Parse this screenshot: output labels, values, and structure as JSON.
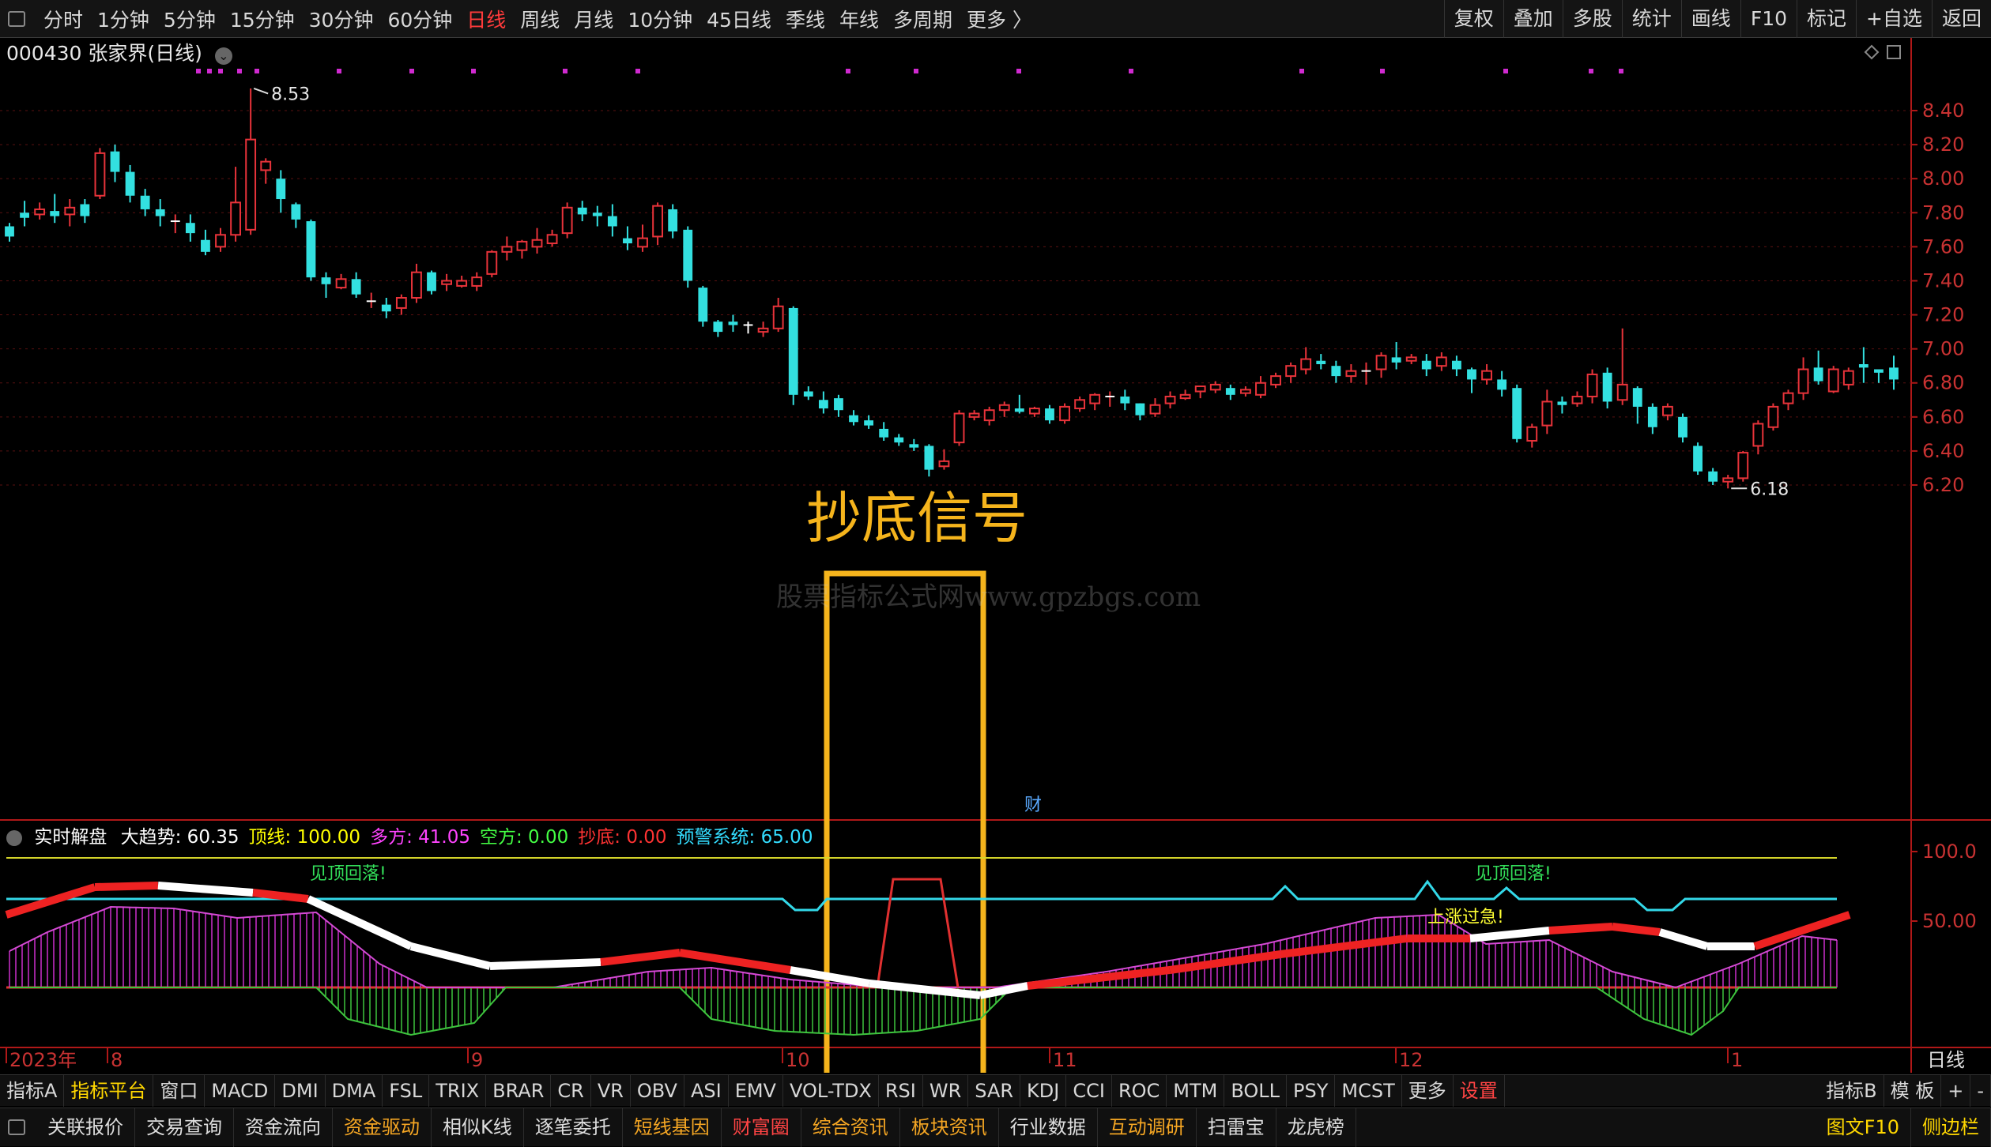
{
  "toolbar": {
    "periods": [
      "分时",
      "1分钟",
      "5分钟",
      "15分钟",
      "30分钟",
      "60分钟",
      "日线",
      "周线",
      "月线",
      "10分钟",
      "45日线",
      "季线",
      "年线",
      "多周期",
      "更多 〉"
    ],
    "active_period": "日线",
    "right_buttons": [
      "复权",
      "叠加",
      "多股",
      "统计",
      "画线",
      "F10",
      "标记",
      "+自选",
      "返回"
    ]
  },
  "stock": {
    "title": "000430 张家界(日线)"
  },
  "price_axis": [
    "8.40",
    "8.20",
    "8.00",
    "7.80",
    "7.60",
    "7.40",
    "7.20",
    "7.00",
    "6.80",
    "6.60",
    "6.40",
    "6.20"
  ],
  "price_markers": {
    "high": "8.53",
    "low": "6.18"
  },
  "annotation": "抄底信号",
  "watermark": "股票指标公式网www.gpzbgs.com",
  "finance_mark": "财",
  "indicator": {
    "name": "实时解盘",
    "items": [
      {
        "label": "大趋势: 60.35",
        "color": "#ffffff"
      },
      {
        "label": "顶线: 100.00",
        "color": "#ffff00"
      },
      {
        "label": "多方: 41.05",
        "color": "#ff44ff"
      },
      {
        "label": "空方: 0.00",
        "color": "#44ff44"
      },
      {
        "label": "抄底: 0.00",
        "color": "#ff3333"
      },
      {
        "label": "预警系统: 65.00",
        "color": "#33ddff"
      }
    ],
    "axis": [
      "100.0",
      "50.00"
    ],
    "texts": {
      "top1": "见顶回落!",
      "top2": "见顶回落!",
      "rise": "上涨过急!"
    }
  },
  "time_axis": {
    "labels": [
      "2023年",
      "8",
      "9",
      "10",
      "11",
      "12",
      "1"
    ],
    "period": "日线"
  },
  "tabs1": [
    "指标A",
    "指标平台",
    "窗口",
    "MACD",
    "DMI",
    "DMA",
    "FSL",
    "TRIX",
    "BRAR",
    "CR",
    "VR",
    "OBV",
    "ASI",
    "EMV",
    "VOL-TDX",
    "RSI",
    "WR",
    "SAR",
    "KDJ",
    "CCI",
    "ROC",
    "MTM",
    "BOLL",
    "PSY",
    "MCST",
    "更多",
    "设置"
  ],
  "tabs1_right": [
    "指标B",
    "模 板",
    "+",
    "-"
  ],
  "tabs2": [
    "关联报价",
    "交易查询",
    "资金流向",
    "资金驱动",
    "相似K线",
    "逐笔委托",
    "短线基因",
    "财富圈",
    "综合资讯",
    "板块资讯",
    "行业数据",
    "互动调研",
    "扫雷宝",
    "龙虎榜"
  ],
  "tabs2_colors": [
    "#dddddd",
    "#dddddd",
    "#dddddd",
    "#f5a623",
    "#dddddd",
    "#dddddd",
    "#f5a623",
    "#ff4444",
    "#f5a623",
    "#f5a623",
    "#dddddd",
    "#f5a623",
    "#dddddd",
    "#dddddd"
  ],
  "tabs2_right": [
    "图文F10",
    "侧边栏"
  ],
  "chart_data": {
    "type": "candlestick",
    "price_range": [
      6.1,
      8.55
    ],
    "candles_note": "daily OHLC, Jul 2023 - Jan 2024",
    "candles": [
      [
        7.72,
        7.66,
        7.63,
        7.74
      ],
      [
        7.8,
        7.77,
        7.72,
        7.87
      ],
      [
        7.79,
        7.82,
        7.76,
        7.86
      ],
      [
        7.81,
        7.78,
        7.74,
        7.91
      ],
      [
        7.79,
        7.83,
        7.72,
        7.88
      ],
      [
        7.85,
        7.78,
        7.74,
        7.88
      ],
      [
        7.9,
        8.15,
        7.88,
        8.18
      ],
      [
        8.16,
        8.04,
        7.98,
        8.2
      ],
      [
        8.04,
        7.9,
        7.86,
        8.08
      ],
      [
        7.9,
        7.82,
        7.78,
        7.94
      ],
      [
        7.82,
        7.78,
        7.72,
        7.88
      ],
      [
        7.74,
        7.75,
        7.68,
        7.79
      ],
      [
        7.74,
        7.68,
        7.63,
        7.79
      ],
      [
        7.64,
        7.57,
        7.55,
        7.7
      ],
      [
        7.6,
        7.67,
        7.57,
        7.71
      ],
      [
        7.67,
        7.86,
        7.63,
        8.07
      ],
      [
        7.7,
        8.23,
        7.67,
        8.53
      ],
      [
        8.05,
        8.1,
        7.97,
        8.12
      ],
      [
        8.0,
        7.88,
        7.8,
        8.05
      ],
      [
        7.85,
        7.76,
        7.71,
        7.86
      ],
      [
        7.75,
        7.42,
        7.4,
        7.76
      ],
      [
        7.42,
        7.38,
        7.3,
        7.45
      ],
      [
        7.36,
        7.41,
        7.35,
        7.44
      ],
      [
        7.41,
        7.32,
        7.3,
        7.45
      ],
      [
        7.27,
        7.28,
        7.24,
        7.33
      ],
      [
        7.26,
        7.22,
        7.18,
        7.3
      ],
      [
        7.24,
        7.3,
        7.2,
        7.32
      ],
      [
        7.3,
        7.45,
        7.27,
        7.5
      ],
      [
        7.45,
        7.34,
        7.32,
        7.46
      ],
      [
        7.38,
        7.4,
        7.34,
        7.44
      ],
      [
        7.37,
        7.4,
        7.36,
        7.43
      ],
      [
        7.37,
        7.42,
        7.34,
        7.45
      ],
      [
        7.44,
        7.57,
        7.42,
        7.58
      ],
      [
        7.57,
        7.6,
        7.52,
        7.66
      ],
      [
        7.58,
        7.63,
        7.53,
        7.64
      ],
      [
        7.6,
        7.64,
        7.56,
        7.71
      ],
      [
        7.62,
        7.67,
        7.6,
        7.7
      ],
      [
        7.68,
        7.83,
        7.65,
        7.86
      ],
      [
        7.83,
        7.79,
        7.75,
        7.87
      ],
      [
        7.8,
        7.78,
        7.72,
        7.84
      ],
      [
        7.78,
        7.72,
        7.66,
        7.85
      ],
      [
        7.65,
        7.62,
        7.58,
        7.72
      ],
      [
        7.6,
        7.65,
        7.57,
        7.73
      ],
      [
        7.66,
        7.84,
        7.61,
        7.86
      ],
      [
        7.82,
        7.69,
        7.65,
        7.85
      ],
      [
        7.7,
        7.4,
        7.36,
        7.72
      ],
      [
        7.36,
        7.16,
        7.13,
        7.37
      ],
      [
        7.16,
        7.1,
        7.07,
        7.17
      ],
      [
        7.16,
        7.14,
        7.1,
        7.2
      ],
      [
        7.14,
        7.13,
        7.09,
        7.16
      ],
      [
        7.1,
        7.12,
        7.07,
        7.16
      ],
      [
        7.12,
        7.25,
        7.1,
        7.3
      ],
      [
        7.24,
        6.73,
        6.67,
        7.25
      ],
      [
        6.75,
        6.72,
        6.7,
        6.78
      ],
      [
        6.7,
        6.65,
        6.62,
        6.75
      ],
      [
        6.71,
        6.64,
        6.6,
        6.73
      ],
      [
        6.61,
        6.57,
        6.55,
        6.64
      ],
      [
        6.58,
        6.55,
        6.53,
        6.61
      ],
      [
        6.53,
        6.48,
        6.46,
        6.57
      ],
      [
        6.48,
        6.45,
        6.43,
        6.5
      ],
      [
        6.44,
        6.42,
        6.4,
        6.47
      ],
      [
        6.43,
        6.29,
        6.25,
        6.44
      ],
      [
        6.31,
        6.34,
        6.29,
        6.41
      ],
      [
        6.45,
        6.62,
        6.43,
        6.64
      ],
      [
        6.6,
        6.62,
        6.58,
        6.64
      ],
      [
        6.58,
        6.64,
        6.55,
        6.66
      ],
      [
        6.64,
        6.67,
        6.6,
        6.69
      ],
      [
        6.65,
        6.63,
        6.62,
        6.73
      ],
      [
        6.62,
        6.65,
        6.6,
        6.66
      ],
      [
        6.65,
        6.58,
        6.56,
        6.67
      ],
      [
        6.58,
        6.66,
        6.56,
        6.68
      ],
      [
        6.65,
        6.7,
        6.63,
        6.72
      ],
      [
        6.68,
        6.73,
        6.64,
        6.74
      ],
      [
        6.72,
        6.72,
        6.66,
        6.75
      ],
      [
        6.72,
        6.68,
        6.64,
        6.76
      ],
      [
        6.68,
        6.61,
        6.58,
        6.68
      ],
      [
        6.62,
        6.67,
        6.6,
        6.71
      ],
      [
        6.68,
        6.72,
        6.65,
        6.75
      ],
      [
        6.71,
        6.73,
        6.7,
        6.76
      ],
      [
        6.75,
        6.78,
        6.71,
        6.78
      ],
      [
        6.76,
        6.79,
        6.74,
        6.81
      ],
      [
        6.77,
        6.73,
        6.7,
        6.79
      ],
      [
        6.74,
        6.76,
        6.72,
        6.78
      ],
      [
        6.73,
        6.8,
        6.71,
        6.84
      ],
      [
        6.79,
        6.84,
        6.77,
        6.86
      ],
      [
        6.84,
        6.9,
        6.8,
        6.92
      ],
      [
        6.88,
        6.94,
        6.85,
        7.01
      ],
      [
        6.93,
        6.91,
        6.88,
        6.97
      ],
      [
        6.9,
        6.84,
        6.8,
        6.93
      ],
      [
        6.84,
        6.87,
        6.8,
        6.91
      ],
      [
        6.86,
        6.87,
        6.79,
        6.92
      ],
      [
        6.88,
        6.96,
        6.83,
        6.98
      ],
      [
        6.95,
        6.92,
        6.88,
        7.04
      ],
      [
        6.93,
        6.95,
        6.91,
        6.97
      ],
      [
        6.93,
        6.88,
        6.84,
        6.97
      ],
      [
        6.9,
        6.95,
        6.87,
        6.98
      ],
      [
        6.93,
        6.88,
        6.84,
        6.96
      ],
      [
        6.88,
        6.82,
        6.74,
        6.89
      ],
      [
        6.82,
        6.87,
        6.79,
        6.91
      ],
      [
        6.82,
        6.76,
        6.72,
        6.87
      ],
      [
        6.77,
        6.47,
        6.45,
        6.79
      ],
      [
        6.46,
        6.54,
        6.42,
        6.56
      ],
      [
        6.55,
        6.69,
        6.5,
        6.76
      ],
      [
        6.69,
        6.67,
        6.62,
        6.72
      ],
      [
        6.68,
        6.72,
        6.66,
        6.75
      ],
      [
        6.72,
        6.85,
        6.68,
        6.88
      ],
      [
        6.86,
        6.69,
        6.65,
        6.89
      ],
      [
        6.7,
        6.79,
        6.67,
        7.12
      ],
      [
        6.77,
        6.66,
        6.56,
        6.78
      ],
      [
        6.66,
        6.54,
        6.5,
        6.68
      ],
      [
        6.61,
        6.66,
        6.58,
        6.68
      ],
      [
        6.6,
        6.48,
        6.45,
        6.62
      ],
      [
        6.43,
        6.28,
        6.26,
        6.45
      ],
      [
        6.28,
        6.22,
        6.2,
        6.3
      ],
      [
        6.22,
        6.24,
        6.18,
        6.26
      ],
      [
        6.24,
        6.39,
        6.22,
        6.4
      ],
      [
        6.43,
        6.56,
        6.38,
        6.58
      ],
      [
        6.54,
        6.66,
        6.52,
        6.68
      ],
      [
        6.68,
        6.74,
        6.64,
        6.76
      ],
      [
        6.74,
        6.88,
        6.7,
        6.95
      ],
      [
        6.89,
        6.81,
        6.79,
        6.99
      ],
      [
        6.75,
        6.88,
        6.74,
        6.9
      ],
      [
        6.79,
        6.87,
        6.76,
        6.89
      ],
      [
        6.91,
        6.89,
        6.8,
        7.01
      ],
      [
        6.88,
        6.86,
        6.8,
        6.88
      ],
      [
        6.89,
        6.82,
        6.76,
        6.96
      ]
    ],
    "indicator_series": {
      "range": [
        0,
        100
      ],
      "top_line": 100.0,
      "warning_system": 65.0,
      "big_trend_last": 60.35,
      "bulls_last": 41.05,
      "bears_last": 0.0,
      "bottom_last": 0.0
    }
  }
}
